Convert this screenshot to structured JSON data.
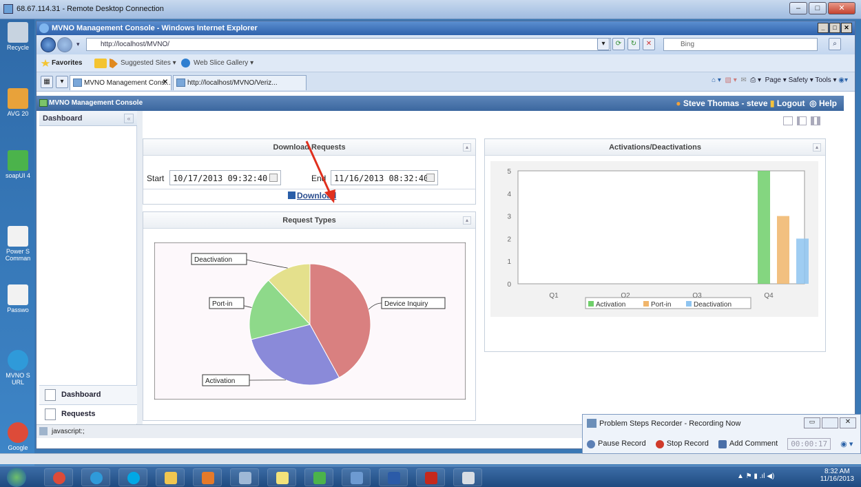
{
  "rdp": {
    "title": "68.67.114.31 - Remote Desktop Connection"
  },
  "desktop_icons": [
    "Recycle",
    "AVG 20",
    "soapUI 4",
    "Power S Comman",
    "Passwo",
    "MVNO S URL",
    "Google"
  ],
  "ie": {
    "title": "MVNO Management Console - Windows Internet Explorer",
    "address": "http://localhost/MVNO/",
    "search_placeholder": "Bing",
    "favorites": {
      "label": "Favorites",
      "suggested": "Suggested Sites ▾",
      "webslice": "Web Slice Gallery ▾"
    },
    "tabs": [
      {
        "label": "MVNO Management Cons..."
      },
      {
        "label": "http://localhost/MVNO/Veriz..."
      }
    ],
    "command_bar": "Page ▾   Safety ▾   Tools ▾"
  },
  "app": {
    "title": "MVNO Management Console",
    "user": "Steve Thomas - steve",
    "logout": "Logout",
    "help": "Help",
    "sidebar": {
      "header": "Dashboard",
      "items": [
        {
          "label": "Dashboard"
        },
        {
          "label": "Requests"
        }
      ]
    },
    "download": {
      "title": "Download Requests",
      "start_label": "Start",
      "start_value": "10/17/2013 09:32:40",
      "end_label": "End",
      "end_value": "11/16/2013 08:32:40",
      "link": "Download"
    },
    "request_types": {
      "title": "Request Types"
    },
    "activations": {
      "title": "Activations/Deactivations"
    }
  },
  "chart_data": [
    {
      "type": "pie",
      "title": "Request Types",
      "labels": [
        "Device Inquiry",
        "Activation",
        "Port-in",
        "Deactivation"
      ],
      "values": [
        42,
        29,
        17,
        12
      ],
      "colors": [
        "#d98080",
        "#8a8ad9",
        "#8ed98a",
        "#e4e08c"
      ]
    },
    {
      "type": "bar",
      "title": "Activations/Deactivations",
      "categories": [
        "Q1",
        "Q2",
        "Q3",
        "Q4"
      ],
      "series": [
        {
          "name": "Activation",
          "values": [
            0,
            0,
            0,
            5
          ],
          "color": "#6fcf6a"
        },
        {
          "name": "Port-in",
          "values": [
            0,
            0,
            0,
            3
          ],
          "color": "#f0b56a"
        },
        {
          "name": "Deactivation",
          "values": [
            0,
            0,
            0,
            2
          ],
          "color": "#8ec4f0"
        }
      ],
      "ylim": [
        0,
        5
      ],
      "yticks": [
        "0",
        "1",
        "2",
        "3",
        "4",
        "5"
      ],
      "legend": "bottom"
    }
  ],
  "status": {
    "text": "javascript:;"
  },
  "psr": {
    "title": "Problem Steps Recorder - Recording Now",
    "pause": "Pause Record",
    "stop": "Stop Record",
    "comment": "Add Comment",
    "timer": "00:00:17"
  },
  "taskbar": {
    "time": "8:32 AM",
    "date": "11/16/2013"
  }
}
